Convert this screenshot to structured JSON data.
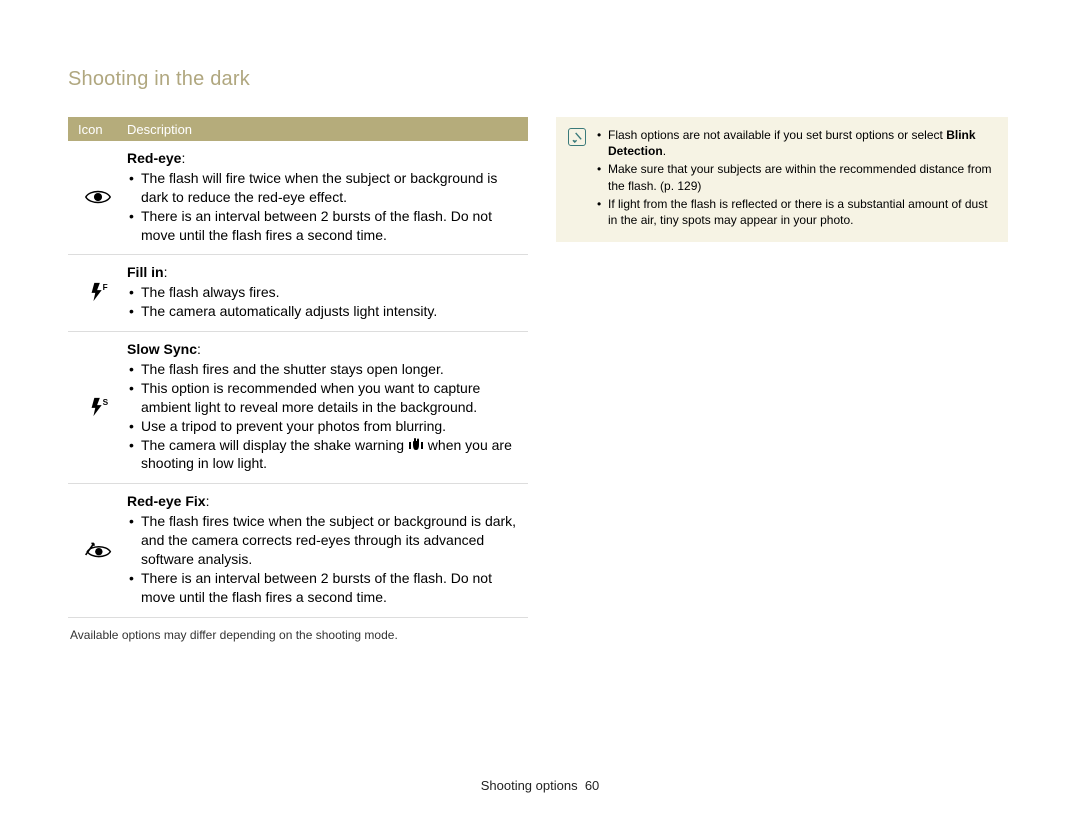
{
  "title": "Shooting in the dark",
  "table": {
    "header_icon": "Icon",
    "header_desc": "Description",
    "rows": [
      {
        "name": "Red-eye",
        "bullets": [
          "The flash will fire twice when the subject or background is dark to reduce the red-eye effect.",
          "There is an interval between 2 bursts of the flash. Do not move until the flash fires a second time."
        ]
      },
      {
        "name": "Fill in",
        "bullets": [
          "The flash always fires.",
          "The camera automatically adjusts light intensity."
        ]
      },
      {
        "name": "Slow Sync",
        "bullets": [
          "The flash fires and the shutter stays open longer.",
          "This option is recommended when you want to capture ambient light to reveal more details in the background.",
          "Use a tripod to prevent your photos from blurring.",
          "The camera will display the shake warning ​ when you are shooting in low light."
        ]
      },
      {
        "name": "Red-eye Fix",
        "bullets": [
          "The flash fires twice when the subject or background is dark, and the camera corrects red-eyes through its advanced software analysis.",
          "There is an interval between 2 bursts of the flash. Do not move until the flash fires a second time."
        ]
      }
    ]
  },
  "footnote": "Available options may differ depending on the shooting mode.",
  "notes": {
    "n0a": "Flash options are not available if you set burst options or select ",
    "n0b": "Blink Detection",
    "n0c": ".",
    "n1": "Make sure that your subjects are within the recommended distance from the flash. (p. 129)",
    "n2": "If light from the flash is reflected or there is a substantial amount of dust in the air, tiny spots may appear in your photo."
  },
  "footer_section": "Shooting options",
  "footer_page": "60"
}
